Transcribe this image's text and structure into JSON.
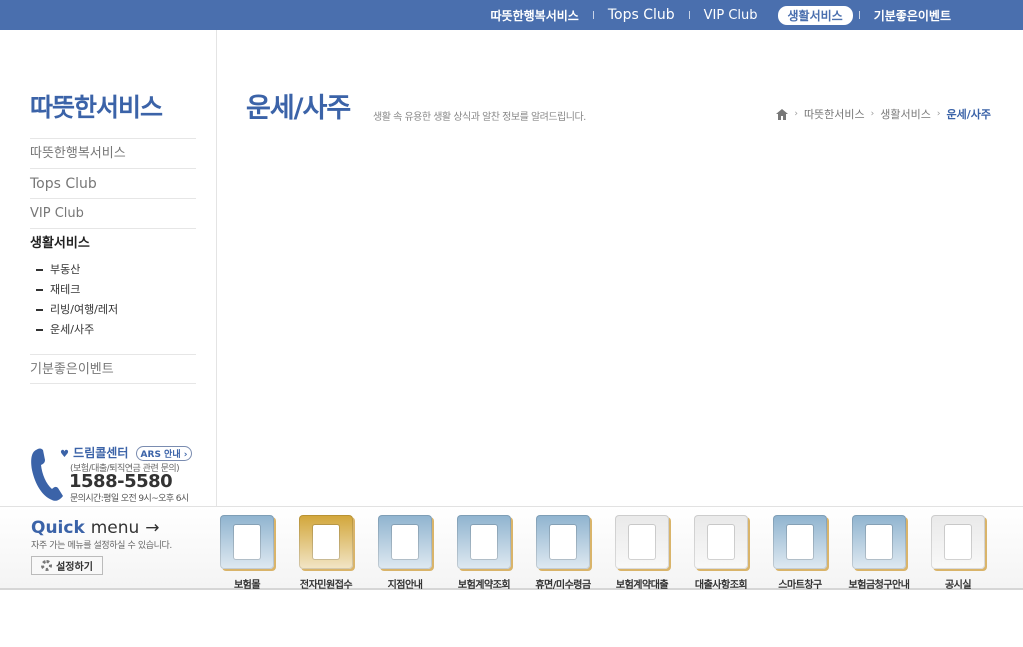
{
  "topnav": {
    "items": [
      {
        "label": "따뜻한행복서비스",
        "active": false
      },
      {
        "label": "Tops Club",
        "active": false
      },
      {
        "label": "VIP Club",
        "active": false
      },
      {
        "label": "생활서비스",
        "active": true
      },
      {
        "label": "기분좋은이벤트",
        "active": false
      }
    ]
  },
  "sidebar": {
    "title": "따뜻한서비스",
    "menu": [
      {
        "label": "따뜻한행복서비스"
      },
      {
        "label": "Tops Club"
      },
      {
        "label": "VIP Club"
      },
      {
        "label": "생활서비스"
      },
      {
        "label": "기분좋은이벤트"
      }
    ],
    "submenu": [
      {
        "label": "부동산"
      },
      {
        "label": "재테크"
      },
      {
        "label": "리빙/여행/레저"
      },
      {
        "label": "운세/사주"
      }
    ],
    "callcenter": {
      "title": "드림콜센터",
      "ars": "ARS 안내",
      "subtitle": "(보험/대출/퇴직연금 관련 문의)",
      "phone": "1588-5580",
      "hours": "문의시간:평일 오전 9시~오후 6시"
    }
  },
  "main": {
    "title": "운세/사주",
    "description": "생활 속 유용한 생활 상식과 알찬 정보를 알려드립니다.",
    "breadcrumb": [
      "따뜻한서비스",
      "생활서비스",
      "운세/사주"
    ]
  },
  "quickmenu": {
    "title": "Quick",
    "title_menu": "menu",
    "desc": "자주 가는 메뉴를 설정하실 수 있습니다.",
    "setting": "설정하기",
    "items": [
      {
        "label": "보험몰",
        "icon": "insurance-mall-icon",
        "color": "#8fb3cf"
      },
      {
        "label": "전자민원접수",
        "icon": "e-complaint-icon",
        "color": "#d2a63a"
      },
      {
        "label": "지점안내",
        "icon": "branch-guide-icon",
        "color": "#8fb3cf"
      },
      {
        "label": "보험계약조회",
        "icon": "contract-search-icon",
        "color": "#8fb3cf"
      },
      {
        "label": "휴면/미수령금",
        "icon": "dormant-money-icon",
        "color": "#8fb3cf"
      },
      {
        "label": "보험계약대출",
        "icon": "contract-loan-icon",
        "color": "#e9e9e9"
      },
      {
        "label": "대출사항조회",
        "icon": "loan-search-icon",
        "color": "#e9e9e9"
      },
      {
        "label": "스마트창구",
        "icon": "smart-window-icon",
        "color": "#8fb3cf"
      },
      {
        "label": "보험금청구안내",
        "icon": "claim-guide-icon",
        "color": "#8fb3cf"
      },
      {
        "label": "공시실",
        "icon": "public-notice-icon",
        "color": "#e9e9e9"
      }
    ]
  }
}
